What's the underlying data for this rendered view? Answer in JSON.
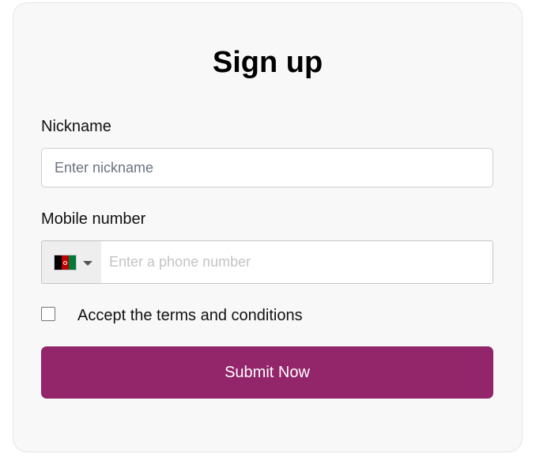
{
  "form": {
    "title": "Sign up",
    "nickname": {
      "label": "Nickname",
      "placeholder": "Enter nickname",
      "value": ""
    },
    "mobile": {
      "label": "Mobile number",
      "placeholder": "Enter a phone number",
      "value": "",
      "country_flag_icon": "afghanistan-flag-icon",
      "flag_colors": [
        "#000000",
        "#be0000",
        "#007a36"
      ]
    },
    "terms": {
      "label": "Accept the terms and conditions",
      "checked": false
    },
    "submit_label": "Submit Now"
  },
  "colors": {
    "accent": "#93256a",
    "card_background": "#f8f8f8"
  }
}
